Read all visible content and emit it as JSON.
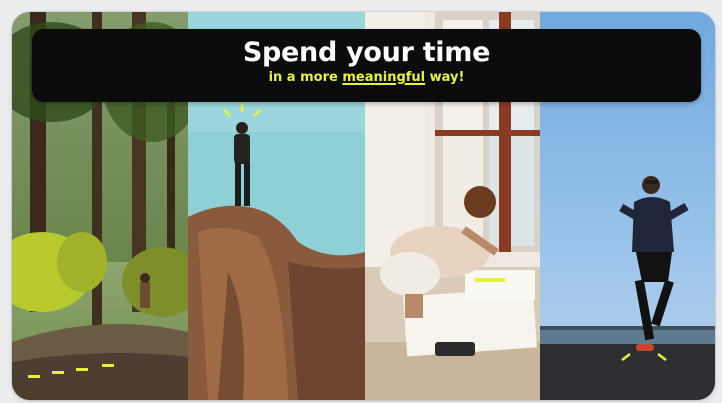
{
  "banner": {
    "headline": "Spend your time",
    "sub_before": "in a more ",
    "sub_highlight": "meaningful",
    "sub_after": " way!"
  },
  "panels": [
    {
      "name": "forest-walk-photo",
      "scene": "forest path with hiker"
    },
    {
      "name": "rock-summit-photo",
      "scene": "hiker standing on rock summit"
    },
    {
      "name": "floor-sketching-photo",
      "scene": "person crouching and drawing on paper"
    },
    {
      "name": "runner-photo",
      "scene": "man running on seaside road"
    }
  ],
  "colors": {
    "accent": "#e9f23a",
    "banner_bg": "#0b0b0b",
    "headline": "#ffffff"
  }
}
